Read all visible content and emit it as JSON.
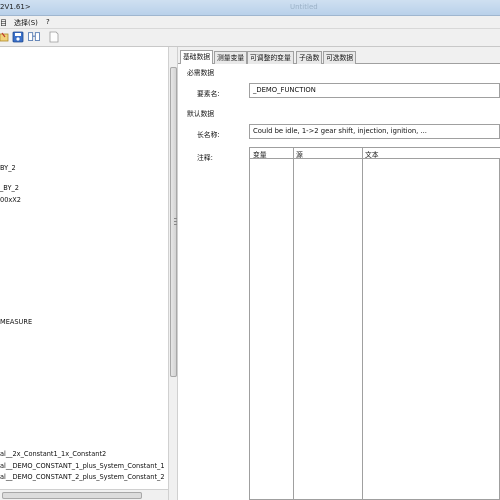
{
  "window": {
    "title": "2V1.61>",
    "ghost_title": "Untitled"
  },
  "menu": {
    "items": [
      "目",
      "选择(S)",
      "?"
    ]
  },
  "toolbar": {
    "icons": [
      "open-icon",
      "save-icon",
      "compare-icon",
      "document-icon"
    ]
  },
  "tree": {
    "items": [
      "BY_2",
      "_BY_2",
      "00xX2",
      "MEASURE",
      "al__2x_Constant1_1x_Constant2",
      "al__DEMO_CONSTANT_1_plus_System_Constant_1",
      "al__DEMO_CONSTANT_2_plus_System_Constant_2"
    ]
  },
  "tabs": [
    "基础数据",
    "测量变量",
    "可调整的变量",
    "子函数",
    "可选数据"
  ],
  "form": {
    "required_section": "必需数据",
    "name_label": "要素名:",
    "name_value": "_DEMO_FUNCTION",
    "default_section": "默认数据",
    "longname_label": "长名称:",
    "longname_value": "Could be idle, 1->2 gear shift, injection, ignition, ...",
    "comment_label": "注释:"
  },
  "comment_table": {
    "columns": [
      "变量",
      "源",
      "文本"
    ]
  }
}
